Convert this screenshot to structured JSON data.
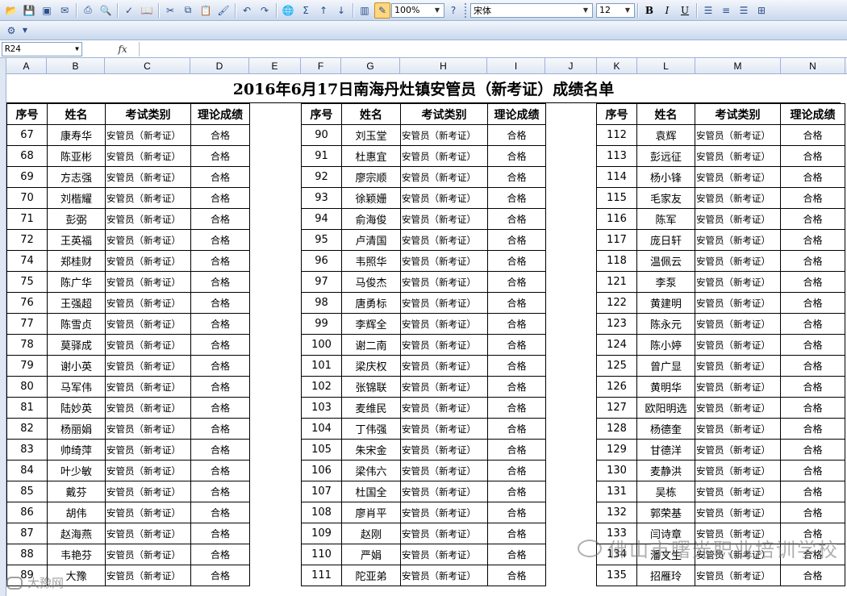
{
  "toolbar": {
    "zoom": "100%",
    "font_name": "宋体",
    "font_size": "12",
    "bold": "B",
    "italic": "I",
    "underline": "U",
    "sum": "Σ"
  },
  "formula_bar": {
    "cell_ref": "R24",
    "fx": "fx",
    "content": ""
  },
  "columns": [
    "A",
    "B",
    "C",
    "D",
    "E",
    "F",
    "G",
    "H",
    "I",
    "J",
    "K",
    "L",
    "M",
    "N"
  ],
  "sheet": {
    "title": "2016年6月17日南海丹灶镇安管员（新考证）成绩名单",
    "headers": [
      "序号",
      "姓名",
      "考试类别",
      "理论成绩"
    ],
    "category": "安管员（新考证）",
    "result": "合格",
    "blocks": [
      {
        "rows": [
          [
            "67",
            "康寿华"
          ],
          [
            "68",
            "陈亚彬"
          ],
          [
            "69",
            "方志强"
          ],
          [
            "70",
            "刘楷耀"
          ],
          [
            "71",
            "彭弼"
          ],
          [
            "72",
            "王英福"
          ],
          [
            "74",
            "郑桂财"
          ],
          [
            "75",
            "陈广华"
          ],
          [
            "76",
            "王强超"
          ],
          [
            "77",
            "陈雪贞"
          ],
          [
            "78",
            "莫驿成"
          ],
          [
            "79",
            "谢小英"
          ],
          [
            "80",
            "马军伟"
          ],
          [
            "81",
            "陆妙英"
          ],
          [
            "82",
            "杨丽娟"
          ],
          [
            "83",
            "帅绮萍"
          ],
          [
            "84",
            "叶少敏"
          ],
          [
            "85",
            "戴芬"
          ],
          [
            "86",
            "胡伟"
          ],
          [
            "87",
            "赵海燕"
          ],
          [
            "88",
            "韦艳芬"
          ],
          [
            "89",
            "大豫"
          ]
        ]
      },
      {
        "rows": [
          [
            "90",
            "刘玉堂"
          ],
          [
            "91",
            "杜惠宜"
          ],
          [
            "92",
            "廖宗顺"
          ],
          [
            "93",
            "徐颖姗"
          ],
          [
            "94",
            "俞海俊"
          ],
          [
            "95",
            "卢清国"
          ],
          [
            "96",
            "韦照华"
          ],
          [
            "97",
            "马俊杰"
          ],
          [
            "98",
            "唐勇标"
          ],
          [
            "99",
            "李辉全"
          ],
          [
            "100",
            "谢二南"
          ],
          [
            "101",
            "梁庆权"
          ],
          [
            "102",
            "张锦联"
          ],
          [
            "103",
            "麦维民"
          ],
          [
            "104",
            "丁伟强"
          ],
          [
            "105",
            "朱宋金"
          ],
          [
            "106",
            "梁伟六"
          ],
          [
            "107",
            "杜国全"
          ],
          [
            "108",
            "廖肖平"
          ],
          [
            "109",
            "赵刚"
          ],
          [
            "110",
            "严娟"
          ],
          [
            "111",
            "陀亚弟"
          ]
        ]
      },
      {
        "rows": [
          [
            "112",
            "袁辉"
          ],
          [
            "113",
            "彭远征"
          ],
          [
            "114",
            "杨小锋"
          ],
          [
            "115",
            "毛家友"
          ],
          [
            "116",
            "陈军"
          ],
          [
            "117",
            "庞日轩"
          ],
          [
            "118",
            "温佩云"
          ],
          [
            "121",
            "李泵"
          ],
          [
            "122",
            "黄建明"
          ],
          [
            "123",
            "陈永元"
          ],
          [
            "124",
            "陈小婷"
          ],
          [
            "125",
            "曾广显"
          ],
          [
            "126",
            "黄明华"
          ],
          [
            "127",
            "欧阳明选"
          ],
          [
            "128",
            "杨德奎"
          ],
          [
            "129",
            "甘德洋"
          ],
          [
            "130",
            "麦静洪"
          ],
          [
            "131",
            "吴栋"
          ],
          [
            "132",
            "郭荣基"
          ],
          [
            "133",
            "闫诗章"
          ],
          [
            "134",
            "潘文生"
          ],
          [
            "135",
            "招雁玲"
          ]
        ]
      }
    ]
  },
  "watermark": {
    "main": "佛山市曙光职业培训学校",
    "secondary": "大豫网"
  }
}
